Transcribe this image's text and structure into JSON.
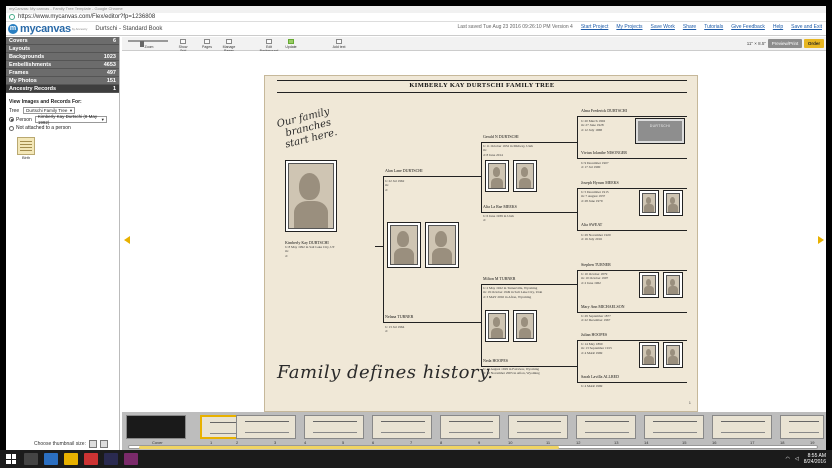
{
  "browser": {
    "title_text": "myCanvas: My canvas - Family Tree Template - Google Chrome",
    "url": "https://www.mycanvas.com/Flex/editor?fp=1236808"
  },
  "app": {
    "logo": "mycanvas",
    "logo_sub": "by Ancestry",
    "project_title": "Durtschi - Standard Book",
    "last_saved": "Last saved Tue Aug 23 2016 09:26:10 PM Version 4",
    "links": [
      "Start Project",
      "My Projects",
      "Save Work",
      "Share",
      "Tutorials",
      "Give Feedback",
      "Help",
      "Save and Exit"
    ]
  },
  "sidebar": {
    "categories": [
      {
        "label": "Covers",
        "count": "6"
      },
      {
        "label": "Layouts",
        "count": ""
      },
      {
        "label": "Backgrounds",
        "count": "1023"
      },
      {
        "label": "Embellishments",
        "count": "4653"
      },
      {
        "label": "Frames",
        "count": "497"
      },
      {
        "label": "My Photos",
        "count": "151"
      },
      {
        "label": "Ancestry Records",
        "count": "1"
      }
    ],
    "records_heading": "View Images and Records For:",
    "tree_label": "Tree",
    "tree_value": "Durtschi Family Tree",
    "person_label": "Person",
    "person_value": "Kimberly Kay Durtschi (8 May 1992)",
    "not_attached_label": "Not attached to a person",
    "thumb_label": "Birth"
  },
  "toolbar": {
    "zoom_label": "Zoom",
    "tools": [
      "Show Grid",
      "Pages",
      "Manage Pages",
      "Edit Background",
      "Update",
      "Add text"
    ],
    "dims": "11\" × 8.5\"",
    "preview_label": "Preview/Print",
    "order_label": "Order"
  },
  "page": {
    "title": "KIMBERLY KAY DURTSCHI FAMILY TREE",
    "quote_top": [
      "Our family",
      "branches",
      "start here."
    ],
    "quote_bottom": "Family defines history.",
    "page_number": "1",
    "tombstone_text": "DURTSCHI",
    "people": {
      "root": {
        "name": "Kimberly Kay DURTSCHI",
        "lines": [
          "b: 8 May 1992 in Salt Lake City, UT",
          "m:",
          "d:"
        ]
      },
      "father": {
        "name": "Alan Lane DURTSCHI",
        "lines": [
          "b: 22 Jul 1962",
          "m:",
          "d:"
        ]
      },
      "mother": {
        "name": "Nelana TURNER",
        "lines": [
          "b: 13 Jul 1964",
          "d:"
        ]
      },
      "pgf": {
        "name": "Gerald N DURTSCHI",
        "lines": [
          "b: 11 October 1932 in Midway, Utah",
          "m:",
          "d: 8 June 2014"
        ]
      },
      "pgm": {
        "name": "Alta La Rae MEEKS",
        "lines": [
          "b: 6 June 1939 in Utah",
          "d:"
        ]
      },
      "mgf": {
        "name": "Milton M TURNER",
        "lines": [
          "b: 2 May 1922 in Turnerville, Wyoming",
          "m: 19 October 1949 in Salt Lake City, Utah",
          "d: 3 MAY 2002 in Afton, Wyoming"
        ]
      },
      "mgm": {
        "name": "Neda HOOPES",
        "lines": [
          "b: 19 August 1929 in Fairview, Wyoming",
          "d: 12 November 2005 in Afton, Wyoming"
        ]
      },
      "gg1": {
        "name": "Alma Frederick DURTSCHI",
        "lines": [
          "b: 20 March 1902",
          "m: 27 June 1928",
          "d: 12 July 1968"
        ]
      },
      "gg2": {
        "name": "Vivian Iolanthe NISONGER",
        "lines": [
          "b: 9 December 1907",
          "d: 17 Jul 1990"
        ]
      },
      "gg3": {
        "name": "Joseph Hyrum MEEKS",
        "lines": [
          "b: 5 December 1915",
          "m: 7 August 1937",
          "d: 28 June 1979"
        ]
      },
      "gg4": {
        "name": "Alta SWEAT",
        "lines": [
          "b: 29 November 1920",
          "d: 16 July 2016"
        ]
      },
      "gg5": {
        "name": "Stephen TURNER",
        "lines": [
          "b: 10 October 1879",
          "m: 10 October 1907",
          "d: 2 June 1962"
        ]
      },
      "gg6": {
        "name": "Mary Ann MICHAELSON",
        "lines": [
          "b: 29 September 1877",
          "d: 22 December 1967"
        ]
      },
      "gg7": {
        "name": "Julian HOOPES",
        "lines": [
          "b: 14 May 1890",
          "m: 13 September 1915",
          "d: 4 MAR 1969"
        ]
      },
      "gg8": {
        "name": "Sarah Lavilla ALLRED",
        "lines": [
          "b: 4 MAR 1969"
        ]
      }
    }
  },
  "filmstrip": {
    "pages": [
      "Cover",
      "1",
      "2",
      "3",
      "4",
      "5",
      "6",
      "7",
      "8",
      "9",
      "10",
      "11",
      "12",
      "13",
      "14",
      "15",
      "16",
      "17",
      "18",
      "19"
    ],
    "size_label": "Choose thumbnail size:"
  },
  "taskbar": {
    "time": "8:55 AM",
    "date": "8/24/2016"
  },
  "colors": {
    "accent": "#e8b100",
    "category_bg": "#6c6c6c",
    "page_bg": "#f0e8d7",
    "link": "#1c5aa8"
  }
}
